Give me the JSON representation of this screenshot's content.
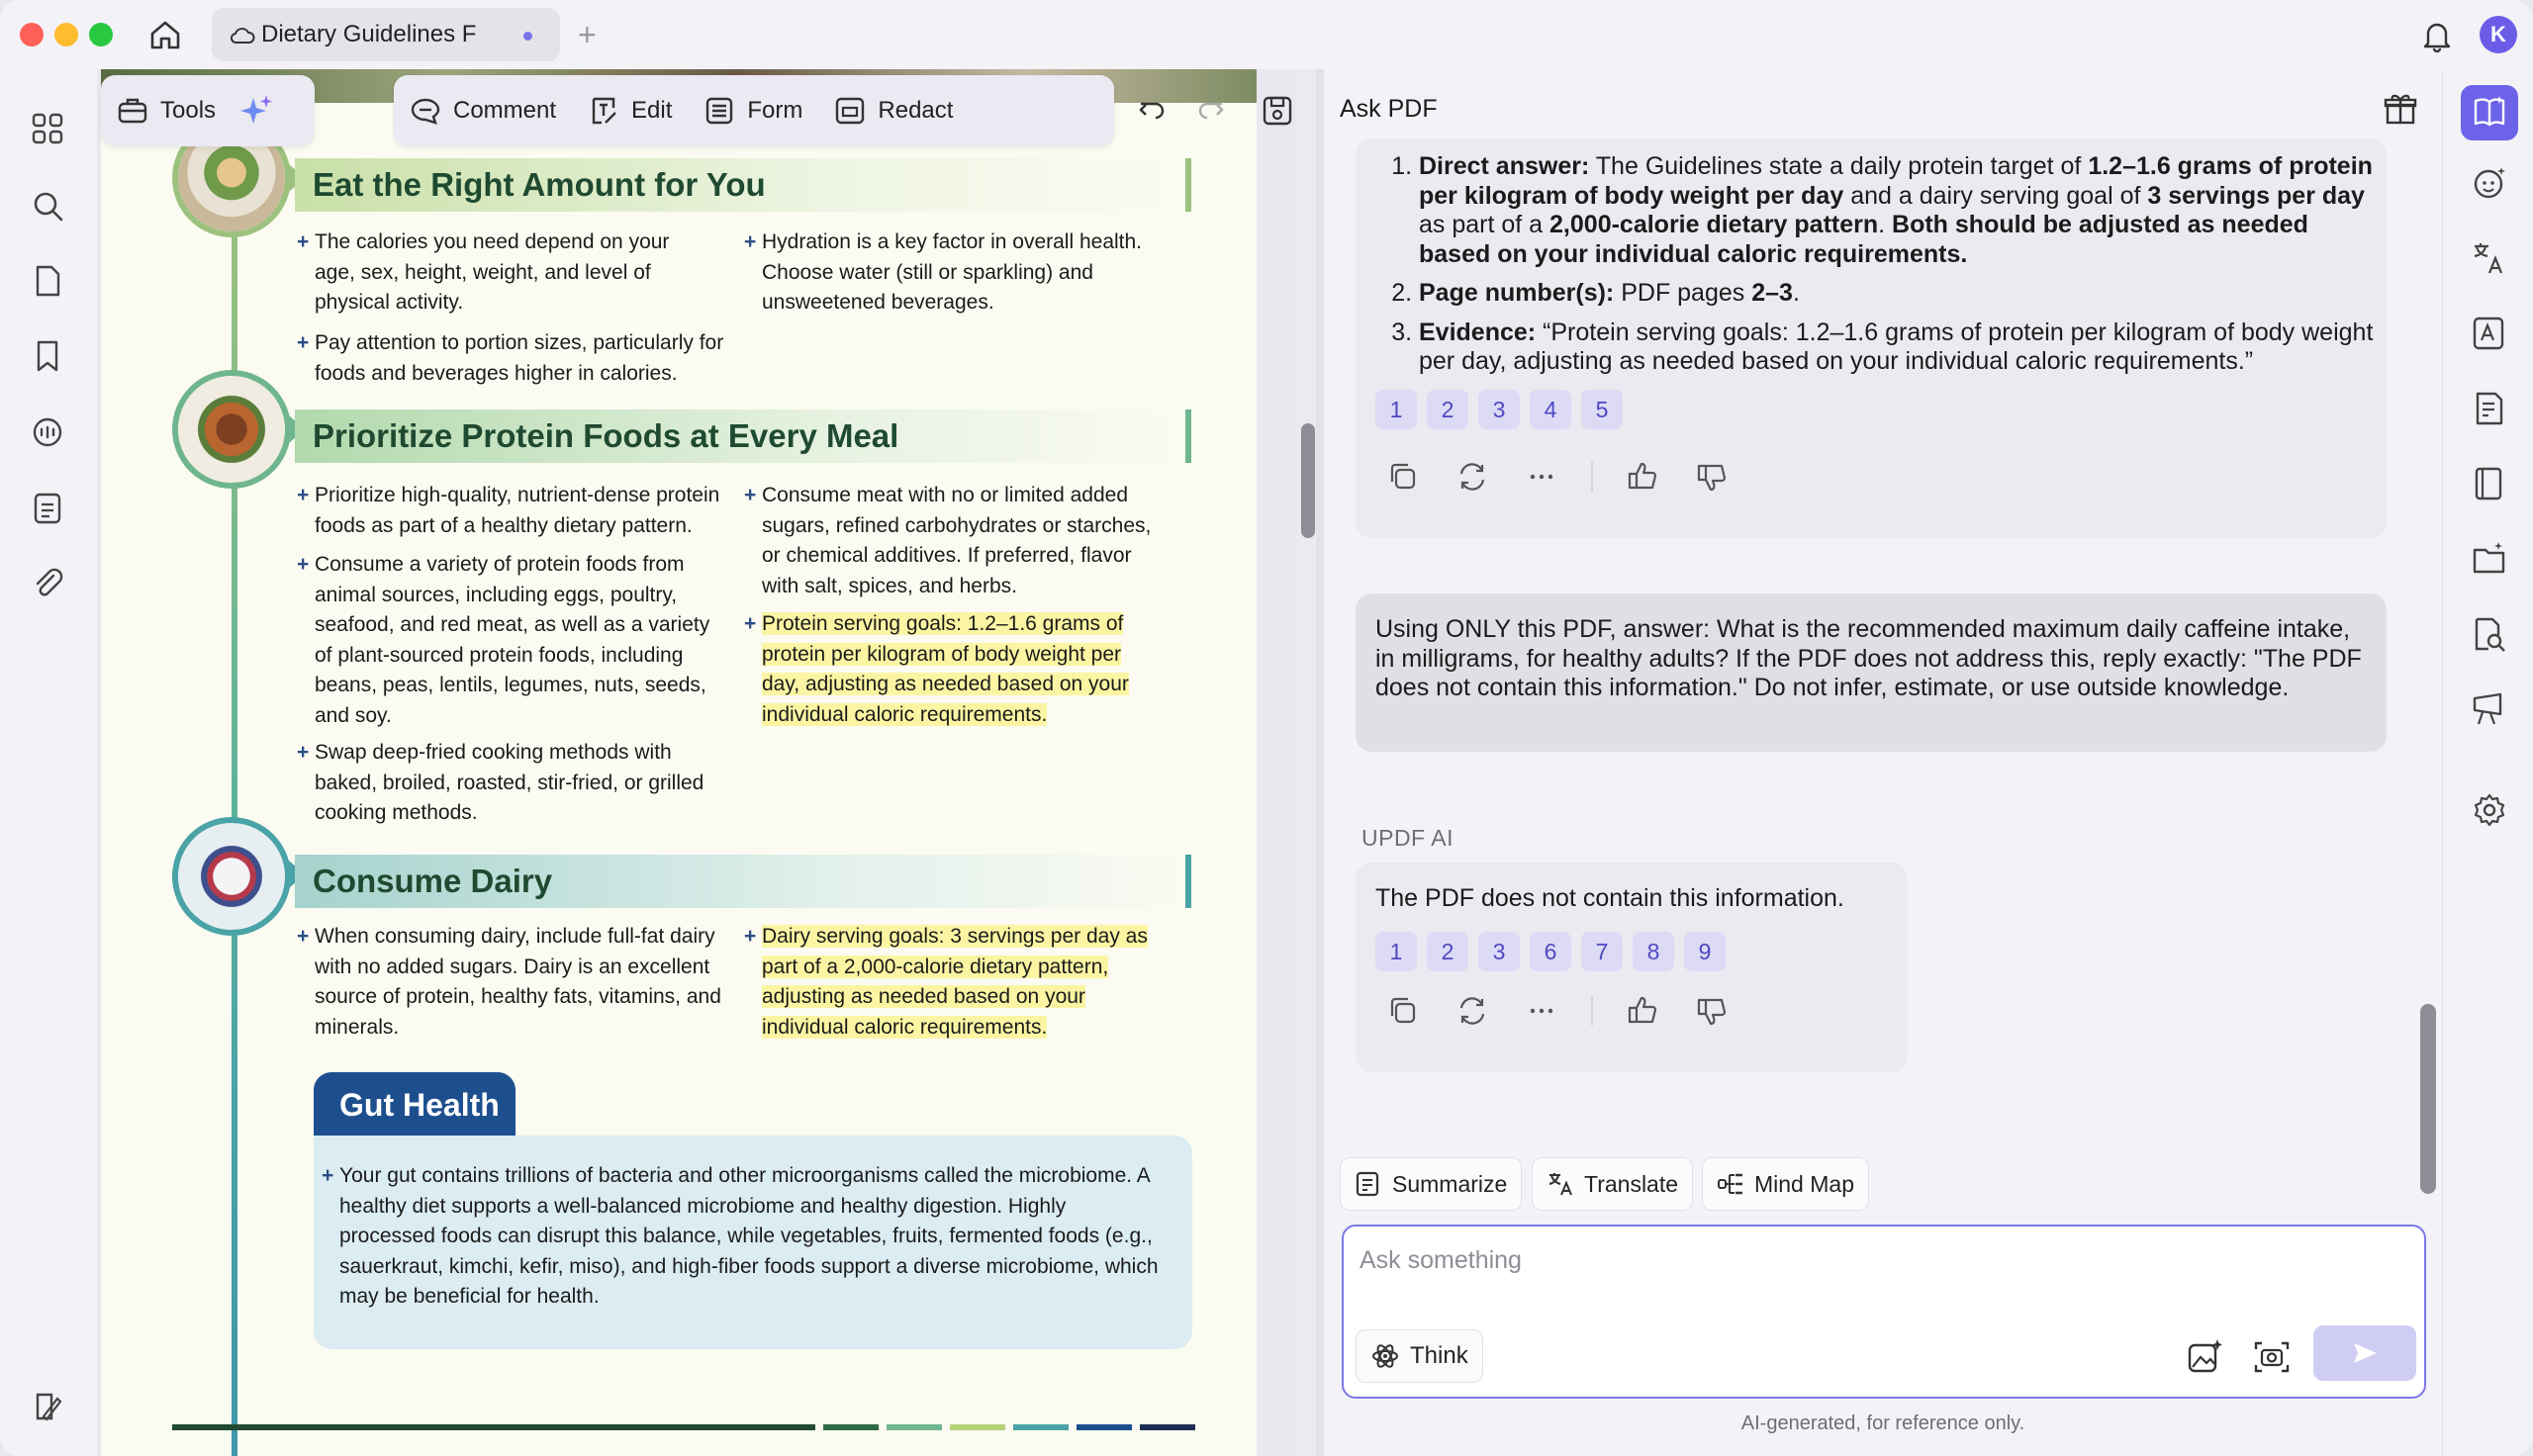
{
  "window": {
    "tab_title": "Dietary Guidelines F",
    "avatar_initial": "K"
  },
  "toolbar": {
    "tools": "Tools",
    "comment": "Comment",
    "edit": "Edit",
    "form": "Form",
    "redact": "Redact"
  },
  "pdf": {
    "sections": [
      {
        "title": "Eat the Right Amount for You",
        "left": [
          "The calories you need depend on your age, sex, height, weight, and level of physical activity.",
          "Pay attention to portion sizes, particularly for foods and beverages higher in calories."
        ],
        "right": [
          "Hydration is a key factor in overall health. Choose water (still or sparkling) and unsweetened beverages."
        ]
      },
      {
        "title": "Prioritize Protein Foods at Every Meal",
        "left": [
          "Prioritize high-quality, nutrient-dense protein foods as part of a healthy dietary pattern.",
          "Consume a variety of protein foods from animal sources, including eggs, poultry, seafood, and red meat, as well as a variety of plant-sourced protein foods, including beans, peas, lentils, legumes, nuts, seeds, and soy.",
          "Swap deep-fried cooking methods with baked, broiled, roasted, stir-fried, or grilled cooking methods."
        ],
        "right": [
          "Consume meat with no or limited added sugars, refined carbohydrates or starches, or chemical additives. If preferred, flavor with salt, spices, and herbs.",
          "Protein serving goals: 1.2–1.6 grams of protein per kilogram of body weight per day, adjusting as needed based on your individual caloric requirements."
        ]
      },
      {
        "title": "Consume Dairy",
        "left": [
          "When consuming dairy, include full-fat dairy with no added sugars. Dairy is an excellent source of protein, healthy fats, vitamins, and minerals."
        ],
        "right": [
          "Dairy serving goals: 3 servings per day as part of a 2,000-calorie dietary pattern, adjusting as needed based on your individual caloric requirements."
        ]
      }
    ],
    "gut": {
      "title": "Gut Health",
      "text": "Your gut contains trillions of bacteria and other microorganisms called the microbiome. A healthy diet supports a well-balanced microbiome and healthy digestion. Highly processed foods can disrupt this balance, while vegetables, fruits, fermented foods (e.g., sauerkraut, kimchi, kefir, miso), and high-fiber foods support a diverse microbiome, which may be beneficial for health."
    }
  },
  "panel": {
    "title": "Ask PDF",
    "answer1": {
      "item1_label": "Direct answer:",
      "item1_a": " The Guidelines state a daily protein target of ",
      "item1_b": "1.2–1.6 grams of protein per kilogram of body weight per day",
      "item1_c": " and a dairy serving goal of ",
      "item1_d": "3 servings per day",
      "item1_e": " as part of a ",
      "item1_f": "2,000-calorie dietary pattern",
      "item1_g": ". ",
      "item1_h": "Both should be adjusted as needed based on your individual caloric requirements.",
      "item2_label": "Page number(s):",
      "item2_text": " PDF pages ",
      "item2_pages": "2–3",
      "item2_end": ".",
      "item3_label": "Evidence:",
      "item3_text": " “Protein serving goals: 1.2–1.6 grams of protein per kilogram of body weight per day, adjusting as needed based on your individual caloric requirements.”",
      "citations": [
        "1",
        "2",
        "3",
        "4",
        "5"
      ]
    },
    "user_message": "Using ONLY this PDF, answer: What is the recommended maximum daily caffeine intake, in milligrams, for healthy adults? If the PDF does not address this, reply exactly: \"The PDF does not contain this information.\" Do not infer, estimate, or use outside knowledge.",
    "ai_label": "UPDF AI",
    "answer2": {
      "text": "The PDF does not contain this information.",
      "citations": [
        "1",
        "2",
        "3",
        "6",
        "7",
        "8",
        "9"
      ]
    },
    "chips": {
      "summarize": "Summarize",
      "translate": "Translate",
      "mindmap": "Mind Map"
    },
    "input_placeholder": "Ask something",
    "think": "Think",
    "disclaimer": "AI-generated, for reference only."
  },
  "colors": {
    "accent": "#6d63e8",
    "highlight": "#fbf5a3",
    "heading_green": "#1f4a31",
    "gut_blue": "#1d4f8f"
  }
}
